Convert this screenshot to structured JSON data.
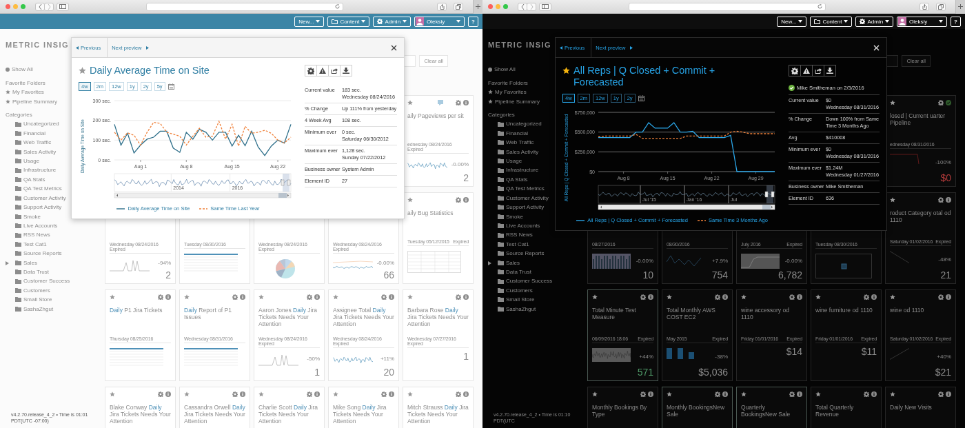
{
  "panes": [
    {
      "kind": "light",
      "topbar": {
        "new": "New...",
        "content": "Content",
        "admin": "Admin",
        "user": "Oleksiy",
        "help": "?"
      },
      "logo": "METRIC INSIG",
      "sidebar": {
        "show_all": "Show All",
        "favorites_heading": "Favorite Folders",
        "favorites": [
          "My Favorites",
          "Pipeline Summary"
        ],
        "categories_heading": "Categories",
        "categories": [
          {
            "label": "Uncategorized",
            "has_children": false
          },
          {
            "label": "Financial",
            "has_children": false
          },
          {
            "label": "Web Traffic",
            "has_children": false
          },
          {
            "label": "Sales Activity",
            "has_children": false
          },
          {
            "label": "Usage",
            "has_children": false
          },
          {
            "label": "Infrastructure",
            "has_children": false
          },
          {
            "label": "QA Stats",
            "has_children": false
          },
          {
            "label": "QA Test Metrics",
            "has_children": false
          },
          {
            "label": "Customer Activity",
            "has_children": false
          },
          {
            "label": "Support Activity",
            "has_children": false
          },
          {
            "label": "Smoke",
            "has_children": false
          },
          {
            "label": "Live Accounts",
            "has_children": false
          },
          {
            "label": "RSS News",
            "has_children": false
          },
          {
            "label": "Test Cat1",
            "has_children": false
          },
          {
            "label": "Source Reports",
            "has_children": false
          },
          {
            "label": "Sales",
            "has_children": true
          },
          {
            "label": "Data Trust",
            "has_children": false
          },
          {
            "label": "Customer Success",
            "has_children": false
          },
          {
            "label": "Customers",
            "has_children": false
          },
          {
            "label": "Small Store",
            "has_children": false
          },
          {
            "label": "SashaZhgut",
            "has_children": false
          }
        ]
      },
      "footer": "v4.2.70.release_4_2 • Time is 01:01 PDT(UTC -07:00)",
      "toolbar": {
        "clear_button": "Clear all"
      },
      "rows": [
        {
          "tiles": [
            {
              "kind": "full",
              "commented": true,
              "title": [
                {
                  "text": "aily Pageviews per sit",
                  "highlight": false
                }
              ],
              "date": "ednesday 08/24/2016",
              "status": "Expired",
              "thumb": {
                "kind": "spark"
              },
              "change": "-0.00%",
              "value": "2"
            }
          ]
        },
        {
          "tiles": [
            {
              "kind": "lower",
              "date": "Wednesday 08/24/2016",
              "status": "Expired",
              "thumb": {
                "kind": "spike"
              },
              "change": "-94%",
              "value": "2"
            },
            {
              "kind": "lower",
              "date": "Tuesday 08/30/2016",
              "thumb": {
                "kind": "table"
              }
            },
            {
              "kind": "lower",
              "date": "Wednesday 08/24/2016",
              "status": "Expired",
              "thumb": {
                "kind": "pie"
              }
            },
            {
              "kind": "lower",
              "date": "Wednesday 08/24/2016",
              "status": "Expired",
              "thumb": {
                "kind": "wave"
              },
              "change": "-0.00%",
              "value": "66"
            },
            {
              "kind": "full",
              "title": [
                {
                  "text": "aily Bug Statistics",
                  "highlight": false
                }
              ],
              "date": "Tuesday 05/12/2015",
              "status": "Expired",
              "thumb": {
                "kind": "grid"
              }
            }
          ]
        },
        {
          "tiles": [
            {
              "kind": "full",
              "title": [
                {
                  "text": "Daily",
                  "highlight": true
                },
                {
                  "text": " P1 Jira Tickets",
                  "highlight": false
                }
              ],
              "date": "Thursday 08/25/2016",
              "thumb": {
                "kind": "table"
              }
            },
            {
              "kind": "full",
              "title": [
                {
                  "text": "Daily",
                  "highlight": true
                },
                {
                  "text": " Report of P1 Issues",
                  "highlight": false
                }
              ],
              "date": "Wednesday 08/31/2016",
              "thumb": {
                "kind": "table"
              }
            },
            {
              "kind": "full",
              "title": [
                {
                  "text": "Aaron Jones ",
                  "highlight": false
                },
                {
                  "text": "Daily",
                  "highlight": true
                },
                {
                  "text": " Jira Tickets Needs Your Attention",
                  "highlight": false
                }
              ],
              "date": "Wednesday 08/24/2016",
              "status": "Expired",
              "thumb": {
                "kind": "spike"
              },
              "change": "-50%",
              "value": "1"
            },
            {
              "kind": "full",
              "title": [
                {
                  "text": "Assignee Total ",
                  "highlight": false
                },
                {
                  "text": "Daily",
                  "highlight": true
                },
                {
                  "text": " Jira Tickets Needs Your Attention",
                  "highlight": false
                }
              ],
              "date": "Wednesday 08/24/2016",
              "status": "Expired",
              "thumb": {
                "kind": "spark"
              },
              "change": "+11%",
              "value": "20"
            },
            {
              "kind": "full",
              "title": [
                {
                  "text": "Barbara Rose ",
                  "highlight": false
                },
                {
                  "text": "Daily",
                  "highlight": true
                },
                {
                  "text": " Jira Tickets Needs Your Attention",
                  "highlight": false
                }
              ],
              "date": "Wednesday 07/27/2016",
              "status": "Expired",
              "value": "1"
            }
          ]
        },
        {
          "tiles": [
            {
              "kind": "full",
              "title": [
                {
                  "text": "Blake Conway ",
                  "highlight": false
                },
                {
                  "text": "Daily",
                  "highlight": true
                },
                {
                  "text": " Jira Tickets Needs Your Attention",
                  "highlight": false
                }
              ]
            },
            {
              "kind": "full",
              "title": [
                {
                  "text": "Cassandra Orwell ",
                  "highlight": false
                },
                {
                  "text": "Daily",
                  "highlight": true
                },
                {
                  "text": " Jira Tickets Needs Your Attention",
                  "highlight": false
                }
              ]
            },
            {
              "kind": "full",
              "title": [
                {
                  "text": "Charlie Scott ",
                  "highlight": false
                },
                {
                  "text": "Daily",
                  "highlight": true
                },
                {
                  "text": " Jira Tickets Needs Your Attention",
                  "highlight": false
                }
              ]
            },
            {
              "kind": "full",
              "title": [
                {
                  "text": "Mike Song ",
                  "highlight": false
                },
                {
                  "text": "Daily",
                  "highlight": true
                },
                {
                  "text": " Jira Tickets Needs Your Attention",
                  "highlight": false
                }
              ]
            },
            {
              "kind": "full",
              "title": [
                {
                  "text": "Mitch Strauss ",
                  "highlight": false
                },
                {
                  "text": "Daily",
                  "highlight": true
                },
                {
                  "text": " Jira Tickets Needs Your Attention",
                  "highlight": false
                }
              ]
            }
          ]
        }
      ],
      "preview": {
        "previous": "Previous",
        "next": "Next preview",
        "favorite": false,
        "title": "Daily Average Time on Site",
        "ranges": [
          {
            "label": "4w",
            "selected": true
          },
          {
            "label": "2m",
            "selected": false
          },
          {
            "label": "12w",
            "selected": false
          },
          {
            "label": "1y",
            "selected": false
          },
          {
            "label": "2y",
            "selected": false
          },
          {
            "label": "5y",
            "selected": false
          }
        ],
        "info": [
          {
            "label": "Current value",
            "lines": [
              "183 sec.",
              "Wednesday 08/24/2016"
            ]
          },
          {
            "label": "% Change",
            "lines": [
              "Up 111% from yesterday"
            ]
          },
          {
            "label": "4 Week Avg",
            "lines": [
              "108 sec."
            ]
          },
          {
            "label": "Minimum ever",
            "lines": [
              "0 sec.",
              "Saturday 06/30/2012"
            ]
          },
          {
            "label": "Maximum ever",
            "lines": [
              "1,128 sec.",
              "Sunday 07/22/2012"
            ]
          },
          {
            "label": "Business owner",
            "lines": [
              "System Admin"
            ]
          },
          {
            "label": "Element ID",
            "lines": [
              "27"
            ]
          }
        ],
        "navigator_labels": [
          "2014",
          "2016"
        ],
        "chart_data": {
          "type": "line",
          "ylabel": "Daily Average Time on Site",
          "categories": [
            null,
            null,
            null,
            null,
            "Aug 1",
            null,
            null,
            null,
            null,
            null,
            null,
            "Aug 8",
            null,
            null,
            null,
            null,
            null,
            null,
            "Aug 15",
            null,
            null,
            null,
            null,
            null,
            null,
            "Aug 22",
            null,
            null
          ],
          "ylim": [
            0,
            300
          ],
          "yticks": [
            {
              "value": 0,
              "label": "0 sec."
            },
            {
              "value": 100,
              "label": "100 sec."
            },
            {
              "value": 200,
              "label": "200 sec."
            },
            {
              "value": 300,
              "label": "300 sec."
            }
          ],
          "series": [
            {
              "name": "Daily Average Time on Site",
              "color": "#2e6f8a",
              "line_style": "solid",
              "values": [
                180,
                75,
                135,
                35,
                75,
                105,
                115,
                145,
                145,
                60,
                38,
                140,
                105,
                155,
                140,
                100,
                140,
                140,
                70,
                125,
                72,
                145,
                65,
                22,
                70,
                100,
                85,
                180
              ]
            },
            {
              "name": "Same Time Last Year",
              "color": "#f0813a",
              "line_style": "dashed",
              "values": [
                140,
                100,
                137,
                125,
                75,
                140,
                190,
                185,
                140,
                130,
                120,
                75,
                120,
                160,
                115,
                120,
                195,
                105,
                180,
                70,
                170,
                135,
                140,
                150,
                135,
                100,
                85,
                115
              ]
            }
          ]
        }
      }
    },
    {
      "kind": "dark",
      "topbar": {
        "new": "New...",
        "content": "Content",
        "admin": "Admin",
        "user": "Oleksiy",
        "help": "?"
      },
      "logo": "METRIC INSIG",
      "sidebar": {
        "show_all": "Show All",
        "favorites_heading": "Favorite Folders",
        "favorites": [
          "My Favorites",
          "Pipeline Summary"
        ],
        "categories_heading": "Categories",
        "categories": [
          {
            "label": "Uncategorized",
            "has_children": false
          },
          {
            "label": "Financial",
            "has_children": false
          },
          {
            "label": "Web Traffic",
            "has_children": false
          },
          {
            "label": "Sales Activity",
            "has_children": false
          },
          {
            "label": "Usage",
            "has_children": false
          },
          {
            "label": "Infrastructure",
            "has_children": false
          },
          {
            "label": "QA Stats",
            "has_children": false
          },
          {
            "label": "QA Test Metrics",
            "has_children": false
          },
          {
            "label": "Customer Activity",
            "has_children": false
          },
          {
            "label": "Support Activity",
            "has_children": false
          },
          {
            "label": "Smoke",
            "has_children": false
          },
          {
            "label": "Live Accounts",
            "has_children": false
          },
          {
            "label": "RSS News",
            "has_children": false
          },
          {
            "label": "Test Cat1",
            "has_children": false
          },
          {
            "label": "Source Reports",
            "has_children": false
          },
          {
            "label": "Sales",
            "has_children": true
          },
          {
            "label": "Data Trust",
            "has_children": false
          },
          {
            "label": "Customer Success",
            "has_children": false
          },
          {
            "label": "Customers",
            "has_children": false
          },
          {
            "label": "Small Store",
            "has_children": false
          },
          {
            "label": "SashaZhgut",
            "has_children": false
          }
        ]
      },
      "footer": "v4.2.70.release_4_2 • Time is 01:10 PDT(UTC",
      "toolbar": {
        "clear_button": "Clear all"
      },
      "rows": [
        {
          "tiles": [
            {
              "kind": "full",
              "approved": true,
              "title": [
                {
                  "text": "losed | Current uarter Pipeline",
                  "highlight": false
                }
              ],
              "date": "ednesday 08/31/2016",
              "thumb": {
                "kind": "redline"
              },
              "change": "-100%",
              "value": "$0",
              "negative": true
            }
          ]
        },
        {
          "tiles": [
            {
              "kind": "lower",
              "date": "08/27/2016",
              "thumb": {
                "kind": "bars"
              },
              "change": "-0.00%",
              "value": "10"
            },
            {
              "kind": "lower",
              "date": "08/30/2016",
              "thumb": {
                "kind": "zigzag"
              },
              "change": "+7.9%",
              "value": "754"
            },
            {
              "kind": "lower",
              "date": "July 2016",
              "status": "Expired",
              "thumb": {
                "kind": "area"
              },
              "change": "-0.00%",
              "value": "6,782"
            },
            {
              "kind": "lower",
              "date": "Tuesday 08/30/2016",
              "thumb": {
                "kind": "frame"
              }
            },
            {
              "kind": "full",
              "title": [
                {
                  "text": "roduct Category otal od 1110",
                  "highlight": false
                }
              ],
              "date": "Saturday 01/02/2016",
              "status": "Expired",
              "thumb": {
                "kind": "line"
              },
              "change": "-48%",
              "value": "21"
            }
          ]
        },
        {
          "tiles": [
            {
              "kind": "full",
              "outlined": true,
              "title": [
                {
                  "text": "Total Minute Test Measure",
                  "highlight": false
                }
              ],
              "date": "06/09/2016 18:06",
              "status": "Expired",
              "thumb": {
                "kind": "noise"
              },
              "change": "+44%",
              "value": "571",
              "positive": true
            },
            {
              "kind": "full",
              "title": [
                {
                  "text": "Total Monthly AWS COST EC2",
                  "highlight": false
                }
              ],
              "date": "May 2015",
              "status": "Expired",
              "thumb": {
                "kind": "columns"
              },
              "change": "-38%",
              "value": "$5,036"
            },
            {
              "kind": "full",
              "title": [
                {
                  "text": "wine accessory od 1110",
                  "highlight": false
                }
              ],
              "date": "Friday 01/01/2016",
              "status": "Expired",
              "value": "$14"
            },
            {
              "kind": "full",
              "title": [
                {
                  "text": "wine furniture od 1110",
                  "highlight": false
                }
              ],
              "date": "Friday 01/01/2016",
              "status": "Expired",
              "value": "$11"
            },
            {
              "kind": "full",
              "title": [
                {
                  "text": "wine od 1110",
                  "highlight": false
                }
              ],
              "date": "Saturday 01/02/2016",
              "status": "Expired",
              "thumb": {
                "kind": "rise"
              },
              "change": "+40%",
              "value": "$21"
            }
          ]
        },
        {
          "tiles": [
            {
              "kind": "full",
              "title": [
                {
                  "text": "Monthly Bookings By Type",
                  "highlight": false
                }
              ]
            },
            {
              "kind": "full",
              "outlined": true,
              "title": [
                {
                  "text": "Monthly BookingsNew Sale",
                  "highlight": false
                }
              ]
            },
            {
              "kind": "full",
              "outlined": true,
              "title": [
                {
                  "text": "Quarterly BookingsNew Sale",
                  "highlight": false
                }
              ]
            },
            {
              "kind": "full",
              "title": [
                {
                  "text": "Total Quarterly Revenue",
                  "highlight": false
                }
              ]
            },
            {
              "kind": "full",
              "title": [
                {
                  "text": "Daily New Visits",
                  "highlight": false
                }
              ]
            }
          ]
        }
      ],
      "preview": {
        "previous": "Previous",
        "next": "Next preview",
        "favorite": true,
        "title": "All Reps | Q Closed + Commit + Forecasted",
        "ranges": [
          {
            "label": "4w",
            "selected": true
          },
          {
            "label": "2m",
            "selected": false
          },
          {
            "label": "12w",
            "selected": false
          },
          {
            "label": "1y",
            "selected": false
          },
          {
            "label": "2y",
            "selected": false
          }
        ],
        "approval": "Mike Smitheman on 2/3/2016",
        "info": [
          {
            "label": "Current value",
            "lines": [
              "$0",
              "Wednesday 08/31/2016"
            ]
          },
          {
            "label": "% Change",
            "lines": [
              "Down 100% from Same Time 3 Months Ago"
            ]
          },
          {
            "label": "Avg",
            "lines": [
              "$410008"
            ]
          },
          {
            "label": "Minimum ever",
            "lines": [
              "$0",
              "Wednesday 08/31/2016"
            ]
          },
          {
            "label": "Maximum ever",
            "lines": [
              "$1.24M",
              "Wednesday 01/27/2016"
            ]
          },
          {
            "label": "Business owner",
            "lines": [
              "Mike Smitheman"
            ]
          },
          {
            "label": "Element ID",
            "lines": [
              "636"
            ]
          }
        ],
        "navigator_labels": [
          "Jul '15",
          "Jan '16",
          "Jul"
        ],
        "chart_data": {
          "type": "line",
          "ylabel": "All Reps | Q Closed + Commit + Forecasted",
          "categories": [
            null,
            null,
            null,
            null,
            "Aug 8",
            null,
            null,
            null,
            null,
            null,
            null,
            "Aug 15",
            null,
            null,
            null,
            null,
            null,
            null,
            "Aug 22",
            null,
            null,
            null,
            null,
            null,
            null,
            "Aug 29",
            null,
            null,
            null
          ],
          "ylim": [
            0,
            750000
          ],
          "yticks": [
            {
              "value": 0,
              "label": "$0"
            },
            {
              "value": 250000,
              "label": "$250,000"
            },
            {
              "value": 500000,
              "label": "$500,000"
            },
            {
              "value": 750000,
              "label": "$750,000"
            }
          ],
          "series": [
            {
              "name": "All Reps | Q Closed + Commit + Forecasted",
              "color": "#2ba6e8",
              "line_style": "solid",
              "values": [
                430000,
                430000,
                430000,
                430000,
                430000,
                430000,
                500000,
                500000,
                620000,
                550000,
                550000,
                550000,
                620000,
                500000,
                500000,
                510000,
                430000,
                430000,
                430000,
                430000,
                430000,
                460000,
                0,
                0,
                0,
                0,
                0,
                0,
                0
              ]
            },
            {
              "name": "Same Time 3 Months Ago",
              "color": "#f0813a",
              "line_style": "dashed",
              "values": [
                440000,
                450000,
                450000,
                450000,
                450000,
                450000,
                470000,
                420000,
                420000,
                420000,
                420000,
                420000,
                420000,
                420000,
                450000,
                450000,
                450000,
                450000,
                450000,
                450000,
                450000,
                500000,
                510000,
                500000,
                480000,
                480000,
                480000,
                480000,
                480000
              ]
            }
          ]
        }
      }
    }
  ]
}
